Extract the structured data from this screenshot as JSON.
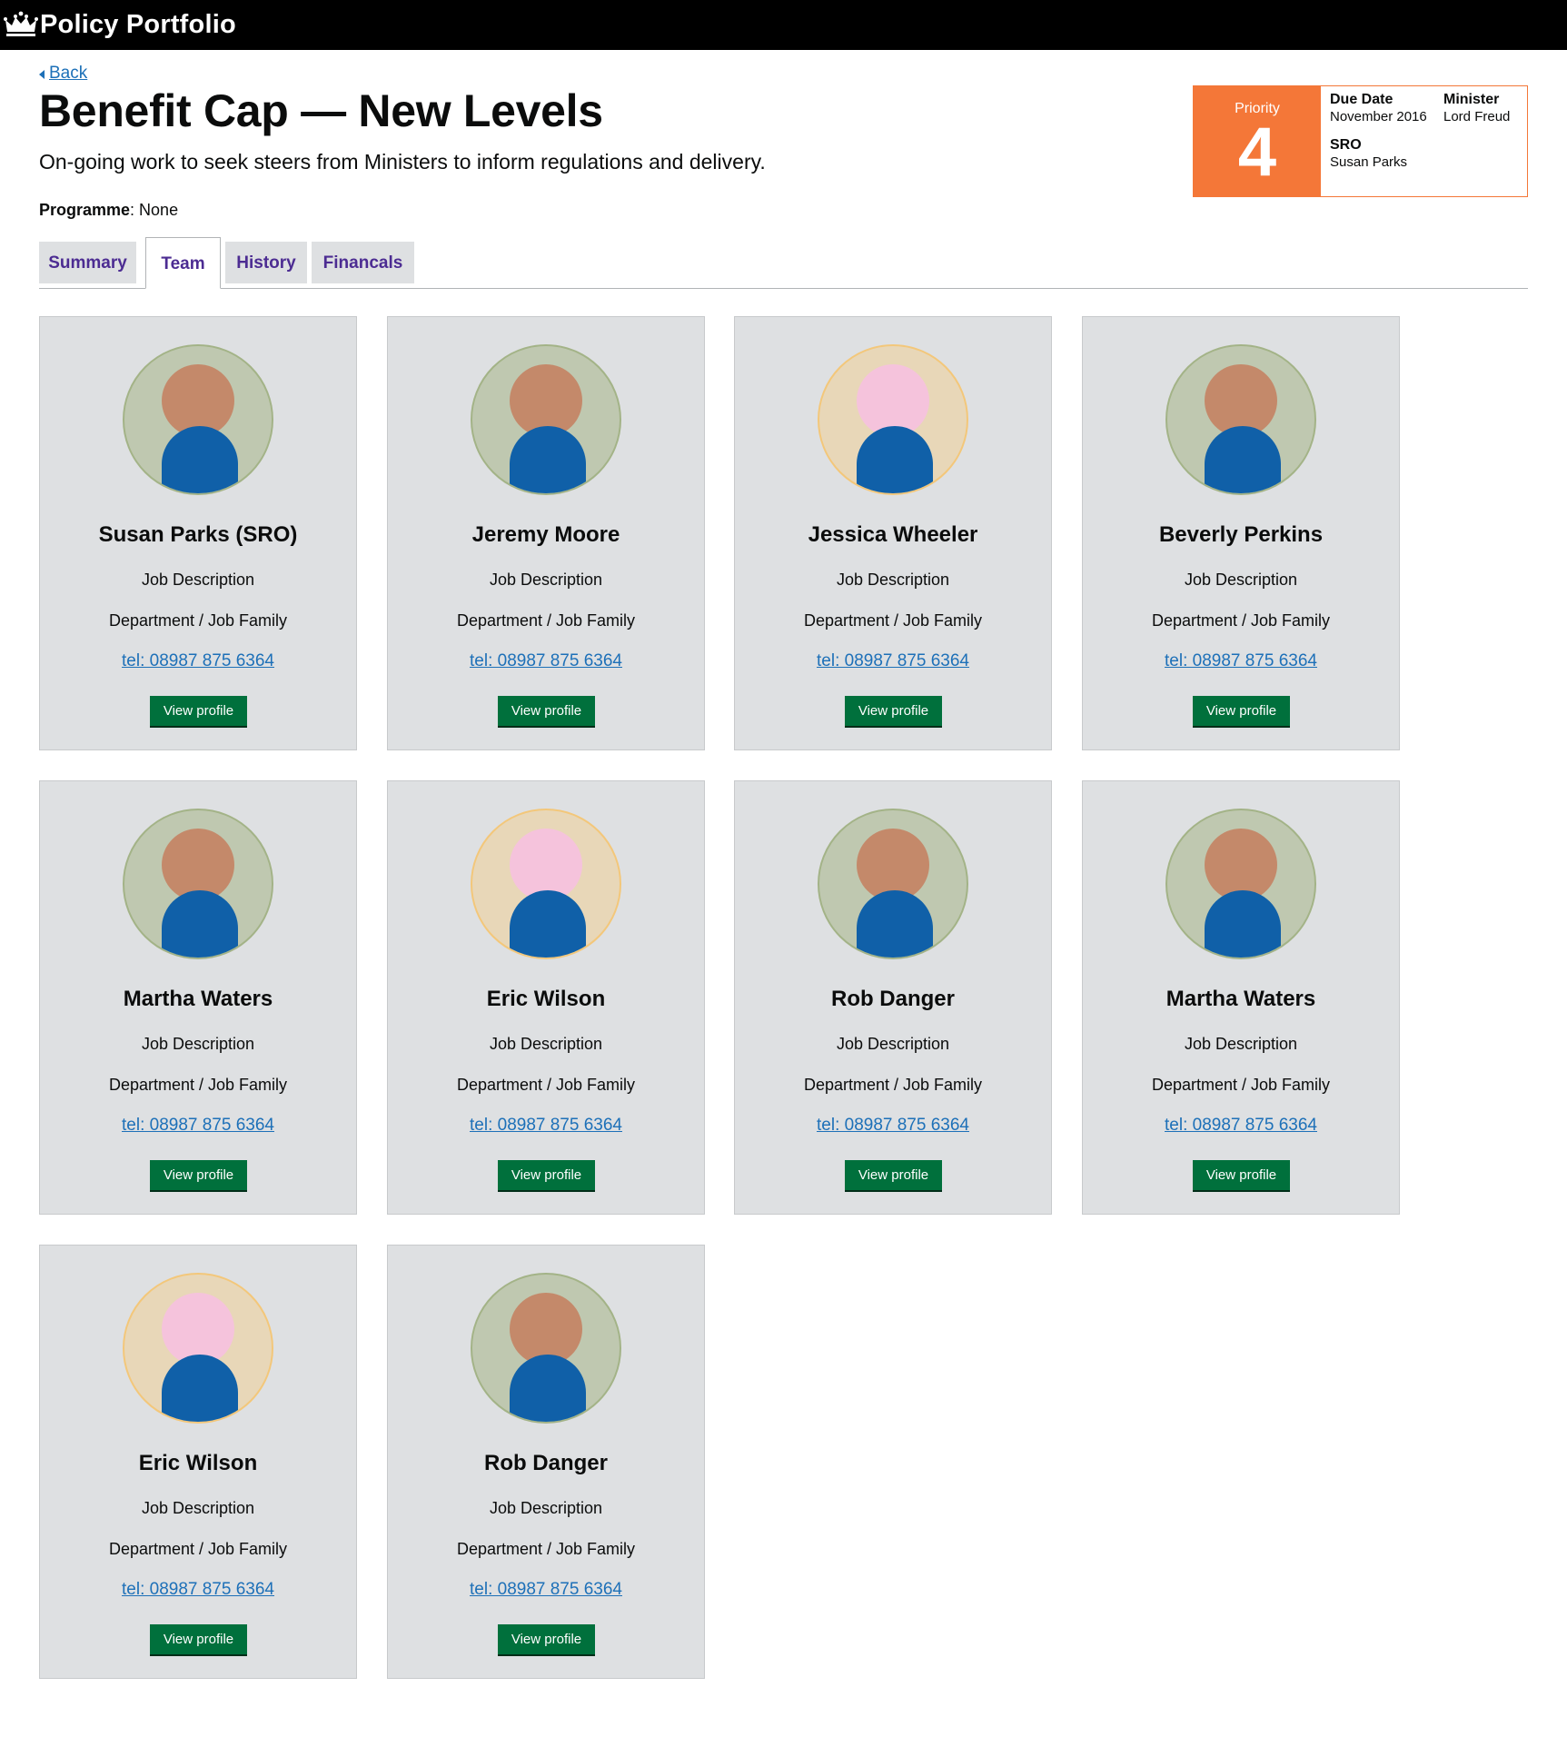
{
  "header": {
    "title": "Policy Portfolio",
    "logo_icon": "crown-icon"
  },
  "back_label": "Back",
  "page": {
    "title": "Benefit Cap — New Levels",
    "lede": "On-going work to seek steers from Ministers to inform regulations and delivery.",
    "programme_label": "Programme",
    "programme_value": ": None"
  },
  "priority_panel": {
    "label": "Priority",
    "value": "4",
    "due_date_label": "Due Date",
    "due_date_value": "November 2016",
    "minister_label": "Minister",
    "minister_value": "Lord Freud",
    "sro_label": "SRO",
    "sro_value": "Susan Parks",
    "accent": "#f47738"
  },
  "tabs": [
    {
      "label": "Summary",
      "active": false
    },
    {
      "label": "Team",
      "active": true
    },
    {
      "label": "History",
      "active": false
    },
    {
      "label": "Financals",
      "active": false
    }
  ],
  "team": [
    {
      "name": "Susan Parks (SRO)",
      "job": "Job Description",
      "department": "Department / Job Family",
      "tel": "tel: 08987 875 6364",
      "button": "View profile",
      "avatar": "green"
    },
    {
      "name": "Jeremy Moore",
      "job": "Job Description",
      "department": "Department / Job Family",
      "tel": "tel: 08987 875 6364",
      "button": "View profile",
      "avatar": "green"
    },
    {
      "name": "Jessica Wheeler",
      "job": "Job Description",
      "department": "Department / Job Family",
      "tel": "tel: 08987 875 6364",
      "button": "View profile",
      "avatar": "peach"
    },
    {
      "name": "Beverly Perkins",
      "job": "Job Description",
      "department": "Department / Job Family",
      "tel": "tel: 08987 875 6364",
      "button": "View profile",
      "avatar": "green"
    },
    {
      "name": "Martha Waters",
      "job": "Job Description",
      "department": "Department / Job Family",
      "tel": "tel: 08987 875 6364",
      "button": "View profile",
      "avatar": "green"
    },
    {
      "name": "Eric Wilson",
      "job": "Job Description",
      "department": "Department / Job Family",
      "tel": "tel: 08987 875 6364",
      "button": "View profile",
      "avatar": "peach"
    },
    {
      "name": "Rob Danger",
      "job": "Job Description",
      "department": "Department / Job Family",
      "tel": "tel: 08987 875 6364",
      "button": "View profile",
      "avatar": "green"
    },
    {
      "name": "Martha Waters",
      "job": "Job Description",
      "department": "Department / Job Family",
      "tel": "tel: 08987 875 6364",
      "button": "View profile",
      "avatar": "green"
    },
    {
      "name": "Eric Wilson",
      "job": "Job Description",
      "department": "Department / Job Family",
      "tel": "tel: 08987 875 6364",
      "button": "View profile",
      "avatar": "peach"
    },
    {
      "name": "Rob Danger",
      "job": "Job Description",
      "department": "Department / Job Family",
      "tel": "tel: 08987 875 6364",
      "button": "View profile",
      "avatar": "green"
    }
  ]
}
